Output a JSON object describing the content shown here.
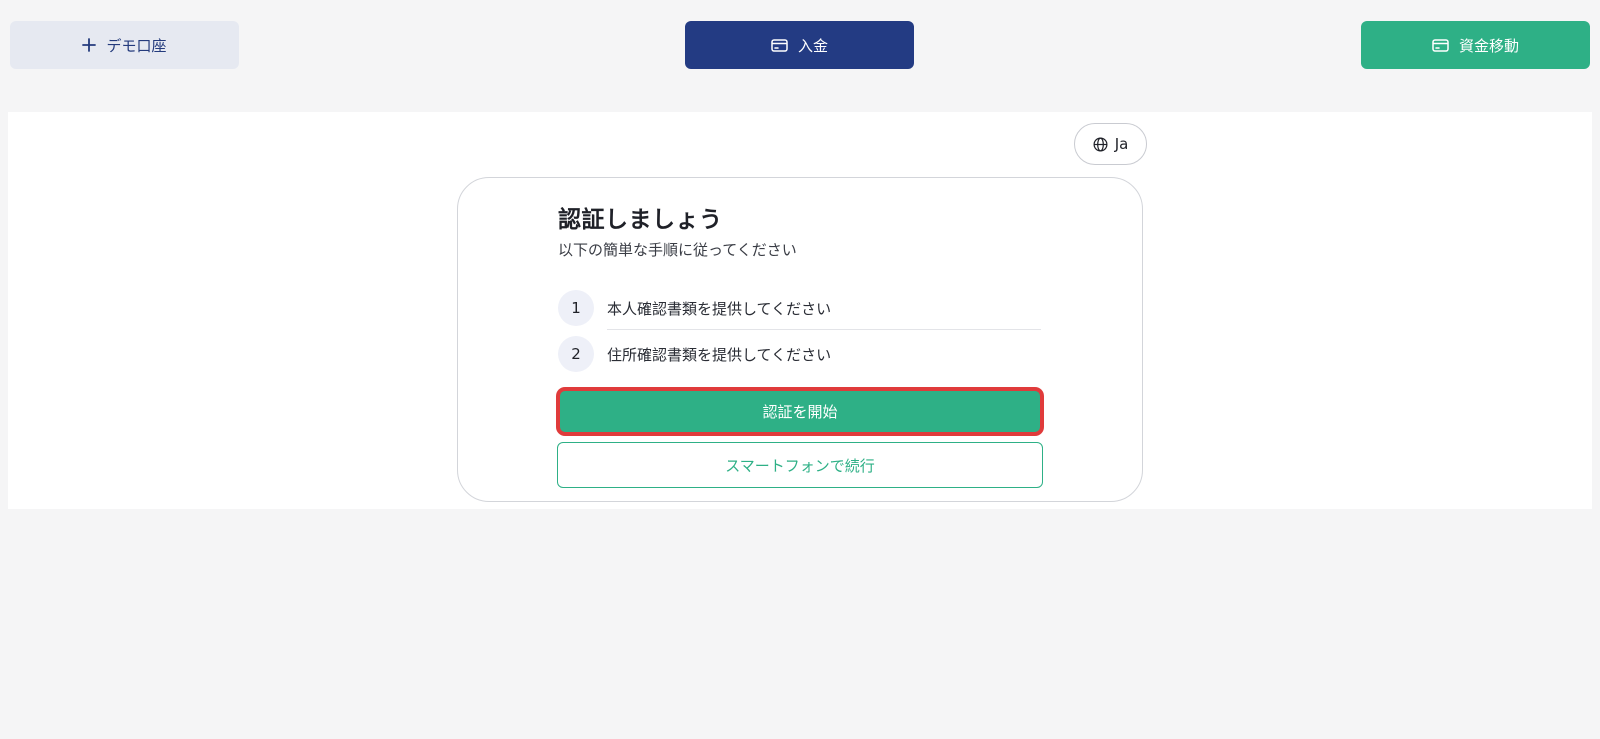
{
  "toolbar": {
    "demo_label": "デモ口座",
    "deposit_label": "入金",
    "transfer_label": "資金移動"
  },
  "language": {
    "label": "Ja"
  },
  "verification": {
    "title": "認証しましょう",
    "subtitle": "以下の簡単な手順に従ってください",
    "steps": [
      {
        "number": "1",
        "label": "本人確認書類を提供してください"
      },
      {
        "number": "2",
        "label": "住所確認書類を提供してください"
      }
    ],
    "start_label": "認証を開始",
    "continue_phone_label": "スマートフォンで続行"
  },
  "colors": {
    "navy": "#233b83",
    "green": "#2eb086",
    "highlight_red": "#e03b3b"
  },
  "icons": {
    "demo": "plus-icon",
    "deposit": "card-icon",
    "transfer": "card-icon",
    "language": "globe-icon"
  }
}
